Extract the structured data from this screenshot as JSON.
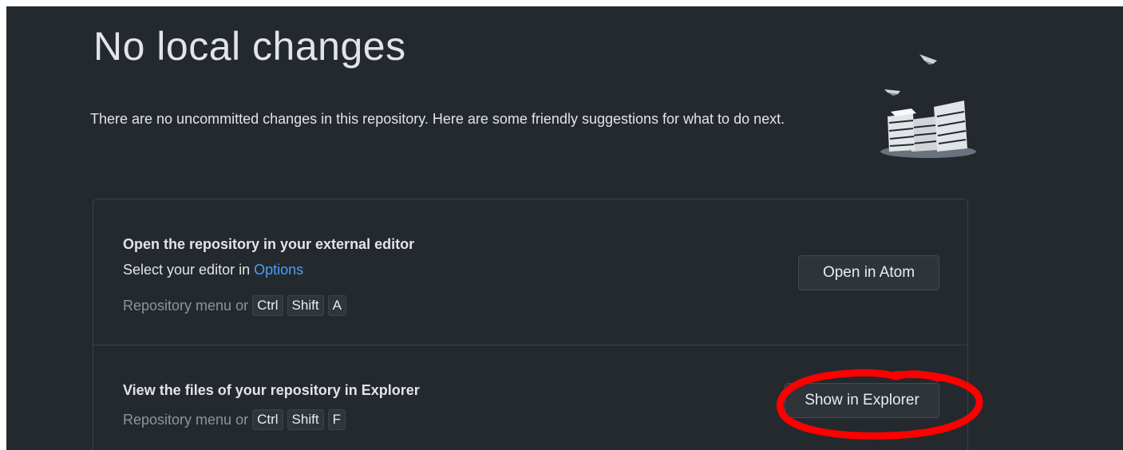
{
  "header": {
    "title": "No local changes",
    "subtitle": "There are no uncommitted changes in this repository. Here are some friendly suggestions for what to do next."
  },
  "suggestions": [
    {
      "title": "Open the repository in your external editor",
      "description_prefix": "Select your editor in ",
      "description_link": "Options",
      "shortcut_prefix": "Repository menu or",
      "keys": [
        "Ctrl",
        "Shift",
        "A"
      ],
      "button_label": "Open in Atom"
    },
    {
      "title": "View the files of your repository in Explorer",
      "shortcut_prefix": "Repository menu or",
      "keys": [
        "Ctrl",
        "Shift",
        "F"
      ],
      "button_label": "Show in Explorer"
    }
  ],
  "colors": {
    "background": "#24292e",
    "link": "#4a9ff8",
    "annotation": "#ff0000"
  }
}
